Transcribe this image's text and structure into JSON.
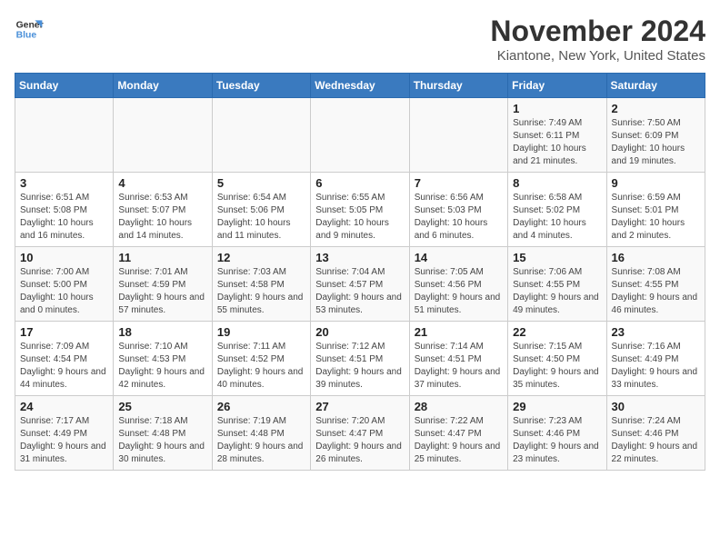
{
  "logo": {
    "line1": "General",
    "line2": "Blue"
  },
  "header": {
    "month": "November 2024",
    "location": "Kiantone, New York, United States"
  },
  "weekdays": [
    "Sunday",
    "Monday",
    "Tuesday",
    "Wednesday",
    "Thursday",
    "Friday",
    "Saturday"
  ],
  "weeks": [
    [
      {
        "day": "",
        "info": ""
      },
      {
        "day": "",
        "info": ""
      },
      {
        "day": "",
        "info": ""
      },
      {
        "day": "",
        "info": ""
      },
      {
        "day": "",
        "info": ""
      },
      {
        "day": "1",
        "info": "Sunrise: 7:49 AM\nSunset: 6:11 PM\nDaylight: 10 hours and 21 minutes."
      },
      {
        "day": "2",
        "info": "Sunrise: 7:50 AM\nSunset: 6:09 PM\nDaylight: 10 hours and 19 minutes."
      }
    ],
    [
      {
        "day": "3",
        "info": "Sunrise: 6:51 AM\nSunset: 5:08 PM\nDaylight: 10 hours and 16 minutes."
      },
      {
        "day": "4",
        "info": "Sunrise: 6:53 AM\nSunset: 5:07 PM\nDaylight: 10 hours and 14 minutes."
      },
      {
        "day": "5",
        "info": "Sunrise: 6:54 AM\nSunset: 5:06 PM\nDaylight: 10 hours and 11 minutes."
      },
      {
        "day": "6",
        "info": "Sunrise: 6:55 AM\nSunset: 5:05 PM\nDaylight: 10 hours and 9 minutes."
      },
      {
        "day": "7",
        "info": "Sunrise: 6:56 AM\nSunset: 5:03 PM\nDaylight: 10 hours and 6 minutes."
      },
      {
        "day": "8",
        "info": "Sunrise: 6:58 AM\nSunset: 5:02 PM\nDaylight: 10 hours and 4 minutes."
      },
      {
        "day": "9",
        "info": "Sunrise: 6:59 AM\nSunset: 5:01 PM\nDaylight: 10 hours and 2 minutes."
      }
    ],
    [
      {
        "day": "10",
        "info": "Sunrise: 7:00 AM\nSunset: 5:00 PM\nDaylight: 10 hours and 0 minutes."
      },
      {
        "day": "11",
        "info": "Sunrise: 7:01 AM\nSunset: 4:59 PM\nDaylight: 9 hours and 57 minutes."
      },
      {
        "day": "12",
        "info": "Sunrise: 7:03 AM\nSunset: 4:58 PM\nDaylight: 9 hours and 55 minutes."
      },
      {
        "day": "13",
        "info": "Sunrise: 7:04 AM\nSunset: 4:57 PM\nDaylight: 9 hours and 53 minutes."
      },
      {
        "day": "14",
        "info": "Sunrise: 7:05 AM\nSunset: 4:56 PM\nDaylight: 9 hours and 51 minutes."
      },
      {
        "day": "15",
        "info": "Sunrise: 7:06 AM\nSunset: 4:55 PM\nDaylight: 9 hours and 49 minutes."
      },
      {
        "day": "16",
        "info": "Sunrise: 7:08 AM\nSunset: 4:55 PM\nDaylight: 9 hours and 46 minutes."
      }
    ],
    [
      {
        "day": "17",
        "info": "Sunrise: 7:09 AM\nSunset: 4:54 PM\nDaylight: 9 hours and 44 minutes."
      },
      {
        "day": "18",
        "info": "Sunrise: 7:10 AM\nSunset: 4:53 PM\nDaylight: 9 hours and 42 minutes."
      },
      {
        "day": "19",
        "info": "Sunrise: 7:11 AM\nSunset: 4:52 PM\nDaylight: 9 hours and 40 minutes."
      },
      {
        "day": "20",
        "info": "Sunrise: 7:12 AM\nSunset: 4:51 PM\nDaylight: 9 hours and 39 minutes."
      },
      {
        "day": "21",
        "info": "Sunrise: 7:14 AM\nSunset: 4:51 PM\nDaylight: 9 hours and 37 minutes."
      },
      {
        "day": "22",
        "info": "Sunrise: 7:15 AM\nSunset: 4:50 PM\nDaylight: 9 hours and 35 minutes."
      },
      {
        "day": "23",
        "info": "Sunrise: 7:16 AM\nSunset: 4:49 PM\nDaylight: 9 hours and 33 minutes."
      }
    ],
    [
      {
        "day": "24",
        "info": "Sunrise: 7:17 AM\nSunset: 4:49 PM\nDaylight: 9 hours and 31 minutes."
      },
      {
        "day": "25",
        "info": "Sunrise: 7:18 AM\nSunset: 4:48 PM\nDaylight: 9 hours and 30 minutes."
      },
      {
        "day": "26",
        "info": "Sunrise: 7:19 AM\nSunset: 4:48 PM\nDaylight: 9 hours and 28 minutes."
      },
      {
        "day": "27",
        "info": "Sunrise: 7:20 AM\nSunset: 4:47 PM\nDaylight: 9 hours and 26 minutes."
      },
      {
        "day": "28",
        "info": "Sunrise: 7:22 AM\nSunset: 4:47 PM\nDaylight: 9 hours and 25 minutes."
      },
      {
        "day": "29",
        "info": "Sunrise: 7:23 AM\nSunset: 4:46 PM\nDaylight: 9 hours and 23 minutes."
      },
      {
        "day": "30",
        "info": "Sunrise: 7:24 AM\nSunset: 4:46 PM\nDaylight: 9 hours and 22 minutes."
      }
    ]
  ]
}
